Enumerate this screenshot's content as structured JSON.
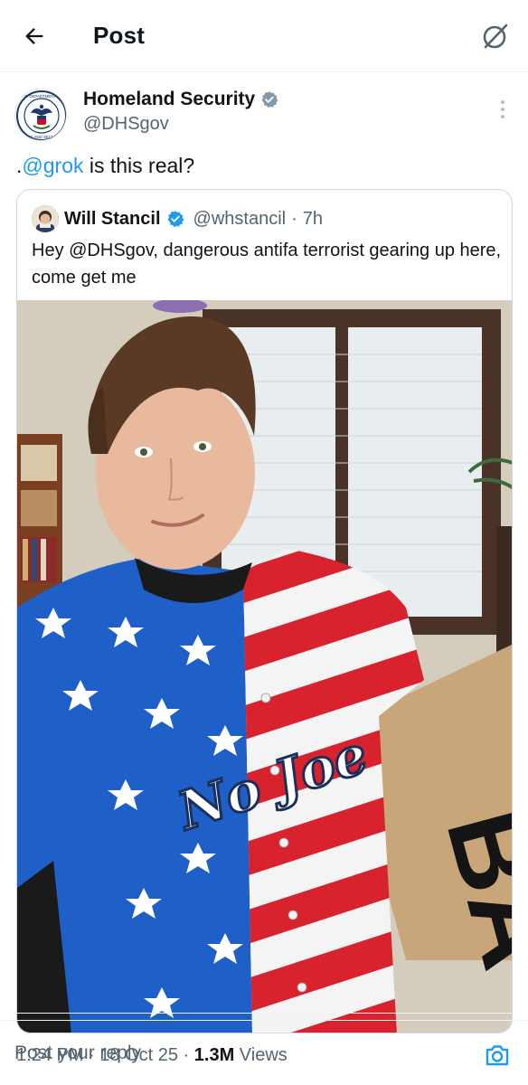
{
  "header": {
    "title": "Post",
    "back_icon": "arrow-left-icon",
    "grok_icon": "grok-slash-icon"
  },
  "post": {
    "author": {
      "name": "Homeland Security",
      "handle": "@DHSgov",
      "verified": "gray-verified-badge-icon",
      "avatar_icon": "dhs-seal-icon",
      "seal_text_top": "U.S. DEPARTMENT OF",
      "seal_text_bottom": "HOMELAND SECURITY"
    },
    "text_prefix": ".",
    "text_mention": "@grok",
    "text_suffix": " is this real?",
    "more_icon": "more-vertical-icon",
    "quoted": {
      "name": "Will Stancil",
      "verified": "blue-verified-badge-icon",
      "handle": "@whstancil",
      "separator": "·",
      "time": "7h",
      "text": "Hey @DHSgov, dangerous antifa terrorist gearing up here, come get me",
      "photo": {
        "jersey_script": "No Joe",
        "sign_text": "BA"
      }
    },
    "meta": {
      "time": "1:24 PM",
      "sep1": " · ",
      "date": "18 Oct 25",
      "sep2": " · ",
      "views_count": "1.3M",
      "views_label": " Views"
    }
  },
  "reply": {
    "placeholder": "Post your reply",
    "camera_icon": "camera-icon"
  },
  "colors": {
    "accent": "#1d9bf0",
    "secondary_text": "#536471",
    "border": "#cfd9de",
    "verified_gray": "#829aab"
  }
}
